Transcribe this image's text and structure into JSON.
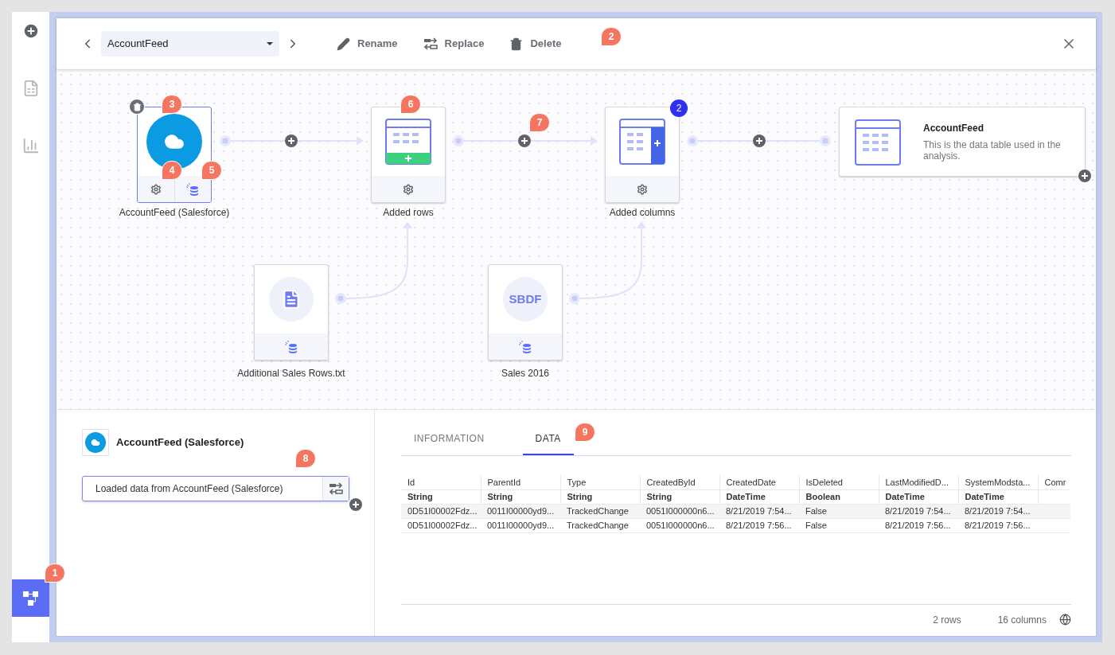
{
  "sidebar": {
    "items": [
      {
        "kind": "add",
        "selected": false
      },
      {
        "kind": "document",
        "selected": false
      },
      {
        "kind": "chart",
        "selected": false
      },
      {
        "kind": "flow",
        "selected": true
      }
    ]
  },
  "header": {
    "table_select": {
      "value": "AccountFeed"
    },
    "actions": [
      {
        "kind": "rename",
        "label": "Rename"
      },
      {
        "kind": "replace",
        "label": "Replace"
      },
      {
        "kind": "delete",
        "label": "Delete"
      }
    ]
  },
  "canvas": {
    "nodes": [
      {
        "kind": "source",
        "label": "AccountFeed (Salesforce)",
        "selected": true
      },
      {
        "kind": "step",
        "label": "Added rows",
        "selected": false
      },
      {
        "kind": "step",
        "label": "Added columns",
        "selected": false,
        "badge": "2"
      },
      {
        "kind": "file",
        "label": "Additional Sales Rows.txt",
        "selected": false
      },
      {
        "kind": "file",
        "icon_text": "SBDF",
        "label": "Sales 2016",
        "selected": false
      }
    ],
    "output": {
      "title": "AccountFeed",
      "description": "This is the data table used in the analysis."
    }
  },
  "details": {
    "source_name": "AccountFeed (Salesforce)",
    "step": "Loaded data from AccountFeed (Salesforce)"
  },
  "tabs": [
    {
      "label": "INFORMATION",
      "selected": false
    },
    {
      "label": "DATA",
      "selected": true
    }
  ],
  "table": {
    "columns": [
      {
        "name": "Id",
        "type": "String"
      },
      {
        "name": "ParentId",
        "type": "String"
      },
      {
        "name": "Type",
        "type": "String"
      },
      {
        "name": "CreatedById",
        "type": "String"
      },
      {
        "name": "CreatedDate",
        "type": "DateTime"
      },
      {
        "name": "IsDeleted",
        "type": "Boolean"
      },
      {
        "name": "LastModifiedD...",
        "type": "DateTime"
      },
      {
        "name": "SystemModsta...",
        "type": "DateTime"
      },
      {
        "name": "Comr"
      }
    ],
    "rows": [
      [
        "0D51I00002Fdz...",
        "0011I00000yd9...",
        "TrackedChange",
        "0051I000000n6...",
        "8/21/2019 7:54...",
        "False",
        "8/21/2019 7:54...",
        "8/21/2019 7:54..."
      ],
      [
        "0D51I00002Fdz...",
        "0011I00000yd9...",
        "TrackedChange",
        "0051I000000n6...",
        "8/21/2019 7:56...",
        "False",
        "8/21/2019 7:56...",
        "8/21/2019 7:56..."
      ]
    ]
  },
  "footer": {
    "rows": "2 rows",
    "columns": "16 columns"
  },
  "callouts": [
    {
      "label": "1"
    },
    {
      "label": "2"
    },
    {
      "label": "3"
    },
    {
      "label": "4"
    },
    {
      "label": "5"
    },
    {
      "label": "6"
    },
    {
      "label": "7"
    },
    {
      "label": "8"
    },
    {
      "label": "9"
    }
  ]
}
